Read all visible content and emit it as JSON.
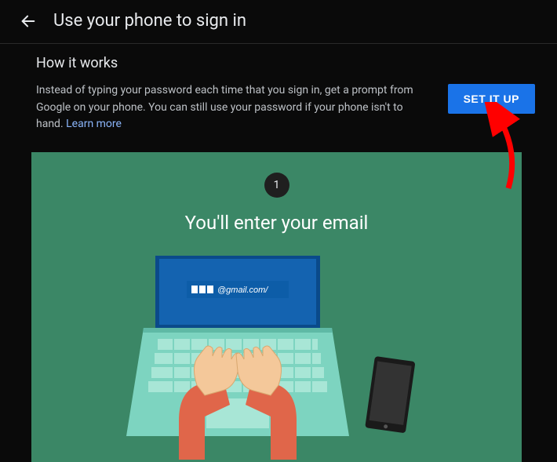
{
  "header": {
    "title": "Use your phone to sign in"
  },
  "section": {
    "title": "How it works",
    "description_a": "Instead of typing your password each time that you sign in, get a prompt from Google on your phone. You can still use your password if your phone isn't to hand. ",
    "learn_more": "Learn more",
    "setup_label": "SET IT UP"
  },
  "step": {
    "number": "1",
    "title": "You'll enter your email",
    "input_placeholder": "@gmail.com/"
  }
}
